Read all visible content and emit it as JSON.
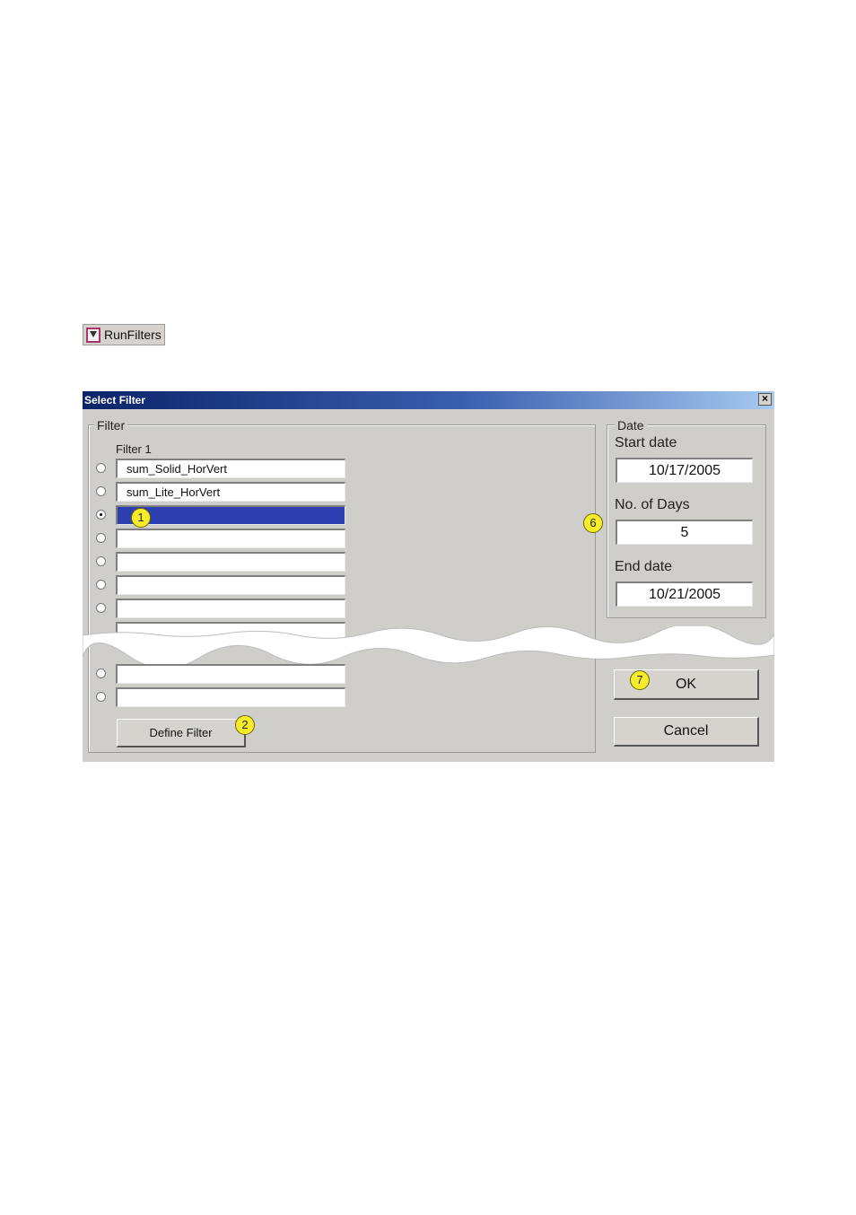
{
  "toolbar": {
    "runfilters_label": "RunFilters",
    "runfilters_icon": "filter-icon"
  },
  "dialog": {
    "title": "Select Filter",
    "close_glyph": "×",
    "filter_group": {
      "legend": "Filter",
      "column_label": "Filter 1",
      "rows": [
        {
          "value": "sum_Solid_HorVert",
          "checked": false
        },
        {
          "value": "sum_Lite_HorVert",
          "checked": false
        },
        {
          "value": "",
          "checked": true,
          "selected": true
        },
        {
          "value": "",
          "checked": false
        },
        {
          "value": "",
          "checked": false
        },
        {
          "value": "",
          "checked": false
        },
        {
          "value": "",
          "checked": false
        },
        {
          "value": "",
          "checked": false
        },
        {
          "value": "",
          "checked": false
        }
      ],
      "define_filter_label": "Define Filter"
    },
    "date_group": {
      "legend": "Date",
      "start_label": "Start date",
      "start_value": "10/17/2005",
      "days_label": "No. of Days",
      "days_value": "5",
      "end_label": "End date",
      "end_value": "10/21/2005"
    },
    "ok_label": "OK",
    "cancel_label": "Cancel"
  },
  "callouts": {
    "c1": "1",
    "c2": "2",
    "c6": "6",
    "c7": "7"
  },
  "colors": {
    "title_start": "#0a246a",
    "selection": "#2d3fb0",
    "callout": "#f7ec2a",
    "dialog_bg": "#cfcecb"
  }
}
